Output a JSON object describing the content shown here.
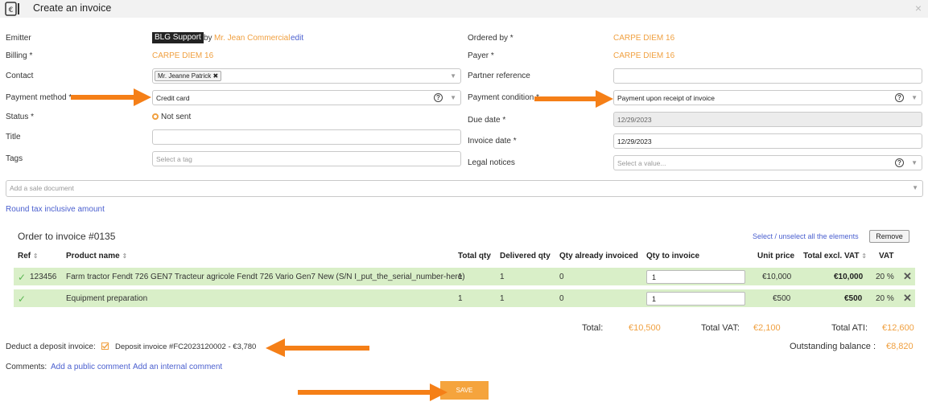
{
  "header": {
    "title": "Create an invoice",
    "close": "×"
  },
  "left": {
    "emitter_label": "Emitter",
    "emitter_badge": "BLG Support",
    "emitter_by": "by",
    "emitter_user": "Mr. Jean Commercial",
    "emitter_edit": "edit",
    "billing_label": "Billing *",
    "billing_value": "CARPE DIEM 16",
    "contact_label": "Contact",
    "contact_tag": "Mr. Jeanne Patrick ✖",
    "payment_method_label": "Payment method *",
    "payment_method_value": "Credit card",
    "status_label": "Status *",
    "status_value": "Not sent",
    "title_label": "Title",
    "title_value": "",
    "tags_label": "Tags",
    "tags_placeholder": "Select a tag"
  },
  "right": {
    "ordered_by_label": "Ordered by *",
    "ordered_by_value": "CARPE DIEM 16",
    "payer_label": "Payer *",
    "payer_value": "CARPE DIEM 16",
    "partner_ref_label": "Partner reference",
    "partner_ref_value": "",
    "payment_condition_label": "Payment condition *",
    "payment_condition_value": "Payment upon receipt of invoice",
    "due_date_label": "Due date *",
    "due_date_value": "12/29/2023",
    "invoice_date_label": "Invoice date *",
    "invoice_date_value": "12/29/2023",
    "legal_notices_label": "Legal notices",
    "legal_notices_placeholder": "Select a value..."
  },
  "sale_doc_placeholder": "Add a sale document",
  "round_tax_link": "Round tax inclusive amount",
  "order": {
    "title": "Order to invoice #0135",
    "select_all": "Select / unselect all the elements",
    "remove": "Remove",
    "headers": [
      "Ref",
      "Product name",
      "Total qty",
      "Delivered qty",
      "Qty already invoiced",
      "Qty to invoice",
      "Unit price",
      "Total excl. VAT",
      "VAT"
    ],
    "rows": [
      {
        "ref": "123456",
        "name": "Farm tractor Fendt 726 GEN7 Tracteur agricole Fendt 726 Vario Gen7 New (S/N I_put_the_serial_number-here)",
        "total_qty": "1",
        "delivered": "1",
        "invoiced": "0",
        "to_invoice": "1",
        "unit_price": "€10,000",
        "total_excl": "€10,000",
        "vat": "20 %"
      },
      {
        "ref": "",
        "name": "Equipment preparation",
        "total_qty": "1",
        "delivered": "1",
        "invoiced": "0",
        "to_invoice": "1",
        "unit_price": "€500",
        "total_excl": "€500",
        "vat": "20 %"
      }
    ]
  },
  "totals": {
    "total_label": "Total:",
    "total_value": "€10,500",
    "vat_label": "Total VAT:",
    "vat_value": "€2,100",
    "ati_label": "Total ATI:",
    "ati_value": "€12,600",
    "outstanding_label": "Outstanding balance :",
    "outstanding_value": "€8,820"
  },
  "deposit": {
    "label": "Deduct a deposit invoice:",
    "value": "Deposit invoice #FC2023120002 - €3,780"
  },
  "comments": {
    "label": "Comments:",
    "public": "Add a public comment",
    "internal": "Add an internal comment"
  },
  "save": "SAVE",
  "colors": {
    "accent": "#f0a040",
    "link": "#4a5fcf",
    "row_bg": "#d9efc8",
    "arrow": "#f57f17"
  },
  "icons": {
    "header": "invoice-euro-icon",
    "help": "question-circle-icon",
    "check": "checkmark-icon",
    "delete": "close-x-icon",
    "sort": "sort-icon"
  }
}
